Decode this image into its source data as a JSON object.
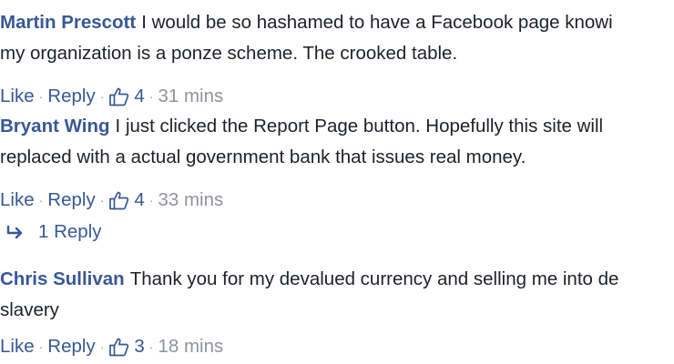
{
  "comments": [
    {
      "author": "Martin Prescott",
      "lines": [
        "I would be so hashamed to have a Facebook page knowi",
        "my organization is a ponze scheme. The crooked table."
      ],
      "like_label": "Like",
      "reply_label": "Reply",
      "like_count": "4",
      "time": "31 mins"
    },
    {
      "author": "Bryant Wing",
      "lines": [
        "I just clicked the Report Page button. Hopefully this site will",
        "replaced with a actual government bank that issues real money."
      ],
      "like_label": "Like",
      "reply_label": "Reply",
      "like_count": "4",
      "time": "33 mins",
      "replies_label": "1 Reply"
    },
    {
      "author": "Chris Sullivan",
      "lines": [
        "Thank you for my devalued currency and selling me into de",
        "slavery"
      ],
      "like_label": "Like",
      "reply_label": "Reply",
      "like_count": "3",
      "time": "18 mins"
    }
  ],
  "icons": {
    "like": "thumbs-up-icon",
    "reply_arrow": "reply-arrow-icon"
  },
  "colors": {
    "link": "#385898",
    "text": "#1d2129",
    "meta": "#90949c"
  }
}
